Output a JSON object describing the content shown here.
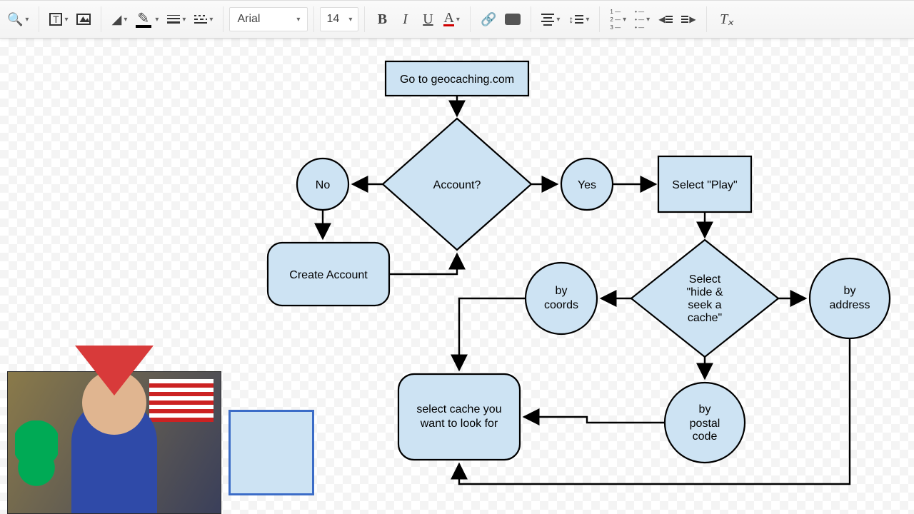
{
  "toolbar": {
    "font": "Arial",
    "size": "14"
  },
  "flow": {
    "start": "Go to geocaching.com",
    "decision_account": "Account?",
    "no": "No",
    "yes": "Yes",
    "select_play": "Select \"Play\"",
    "create_account": "Create Account",
    "decision_hide1": "Select",
    "decision_hide2": "\"hide &",
    "decision_hide3": "seek a",
    "decision_hide4": "cache\"",
    "by_coords1": "by",
    "by_coords2": "coords",
    "by_addr1": "by",
    "by_addr2": "address",
    "by_postal1": "by",
    "by_postal2": "postal",
    "by_postal3": "code",
    "select_cache1": "select cache you",
    "select_cache2": "want to look for"
  }
}
